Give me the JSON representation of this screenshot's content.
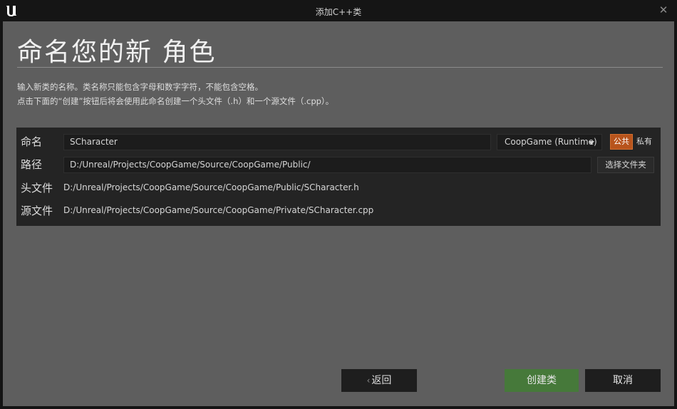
{
  "window": {
    "title": "添加C++类",
    "close_glyph": "✕"
  },
  "header": {
    "heading": "命名您的新 角色",
    "desc_line1": "输入新类的名称。类名称只能包含字母和数字字符，不能包含空格。",
    "desc_line2": "点击下面的“创建”按钮后将会使用此命名创建一个头文件（.h）和一个源文件（.cpp）。"
  },
  "form": {
    "name_label": "命名",
    "name_value": "SCharacter",
    "module_value": "CoopGame (Runtime)",
    "public_label": "公共",
    "private_label": "私有",
    "path_label": "路径",
    "path_value": "D:/Unreal/Projects/CoopGame/Source/CoopGame/Public/",
    "choose_folder_label": "选择文件夹",
    "header_label": "头文件",
    "header_path": "D:/Unreal/Projects/CoopGame/Source/CoopGame/Public/SCharacter.h",
    "source_label": "源文件",
    "source_path": "D:/Unreal/Projects/CoopGame/Source/CoopGame/Private/SCharacter.cpp"
  },
  "footer": {
    "back_label": "返回",
    "create_label": "创建类",
    "cancel_label": "取消"
  },
  "colors": {
    "accent_public": "#b8541c",
    "create_green": "#46793a",
    "content_bg": "#5e5e5e",
    "panel_bg": "#242424"
  }
}
